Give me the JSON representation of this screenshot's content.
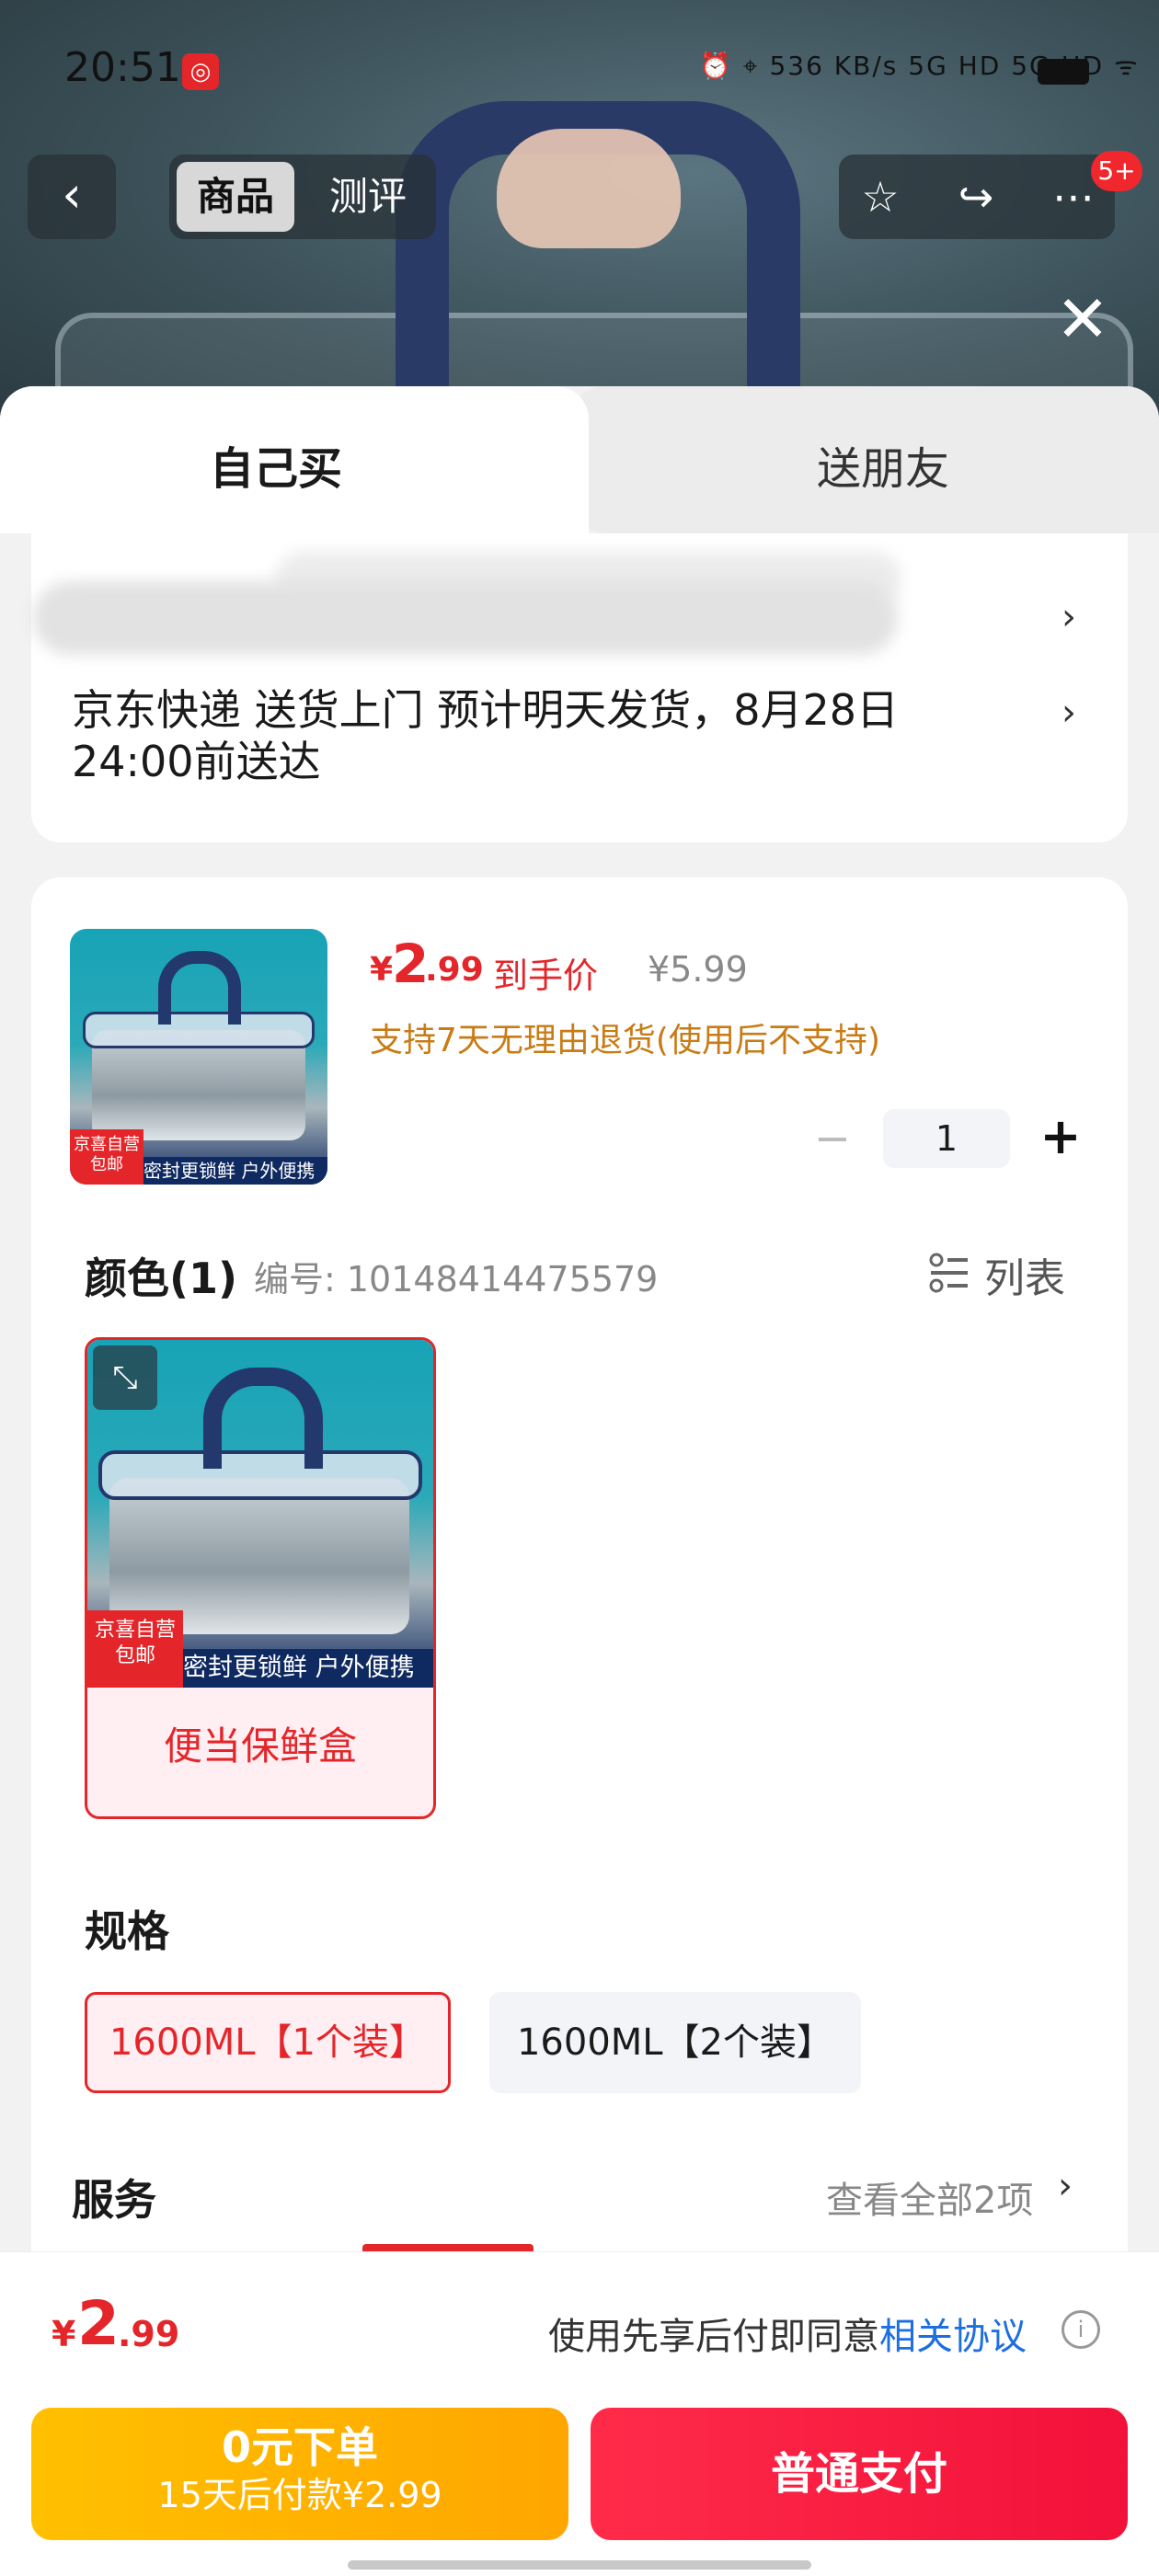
{
  "status_bar": {
    "time": "20:51",
    "net_speed": "536 KB/s",
    "signal": "5G HD  5G HD"
  },
  "nav": {
    "tabs": [
      "商品",
      "测评"
    ],
    "badge": "5+"
  },
  "sheet": {
    "tabs": {
      "self": "自己买",
      "friend": "送朋友"
    },
    "shipping": "京东快递 送货上门 预计明天发货，8月28日24:00前送达",
    "chevron": "›"
  },
  "product": {
    "currency": "¥",
    "price_int": "2",
    "price_dec": ".99",
    "price_tag": "到手价",
    "original_price": "¥5.99",
    "return_policy": "支持7天无理由退货(使用后不支持)",
    "quantity": "1",
    "thumb_tag": "京喜自营\n包邮",
    "thumb_strip": "密封更锁鲜 户外便携"
  },
  "color": {
    "label": "颜色(1)",
    "code": "编号: 10148414475579",
    "list_label": "列表",
    "options": [
      {
        "label": "便当保鲜盒"
      }
    ]
  },
  "spec": {
    "label": "规格",
    "options": [
      "1600ML【1个装】",
      "1600ML【2个装】"
    ],
    "selected": 0
  },
  "service": {
    "label": "服务",
    "view_all": "查看全部2项"
  },
  "footer": {
    "currency": "¥",
    "price_int": "2",
    "price_dec": ".99",
    "agree_text": "使用先享后付即同意",
    "agree_link": "相关协议",
    "later_line1": "0元下单",
    "later_line2": "15天后付款¥2.99",
    "pay_label": "普通支付"
  },
  "colors": {
    "accent_red": "#e4262a",
    "pay_red": "#f2113a",
    "later_yellow": "#ffb300",
    "link_blue": "#1d6fe0"
  }
}
